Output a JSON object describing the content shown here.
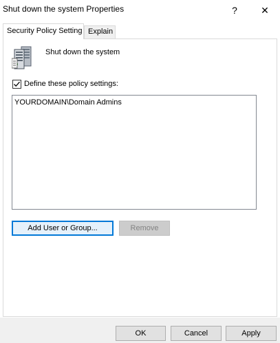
{
  "window": {
    "title": "Shut down the system Properties",
    "help_glyph": "?",
    "close_glyph": "✕"
  },
  "tabs": [
    {
      "label": "Security Policy Setting",
      "active": true
    },
    {
      "label": "Explain",
      "active": false
    }
  ],
  "policy": {
    "icon": "server-policy-icon",
    "name": "Shut down the system"
  },
  "define_checkbox": {
    "label": "Define these policy settings:",
    "checked": true
  },
  "members": [
    "YOURDOMAIN\\Domain Admins"
  ],
  "buttons": {
    "add": "Add User or Group...",
    "remove": "Remove",
    "ok": "OK",
    "cancel": "Cancel",
    "apply": "Apply"
  },
  "colors": {
    "focus_border": "#0078d7",
    "dialog_bg": "#ffffff",
    "footer_bg": "#f0f0f0"
  }
}
